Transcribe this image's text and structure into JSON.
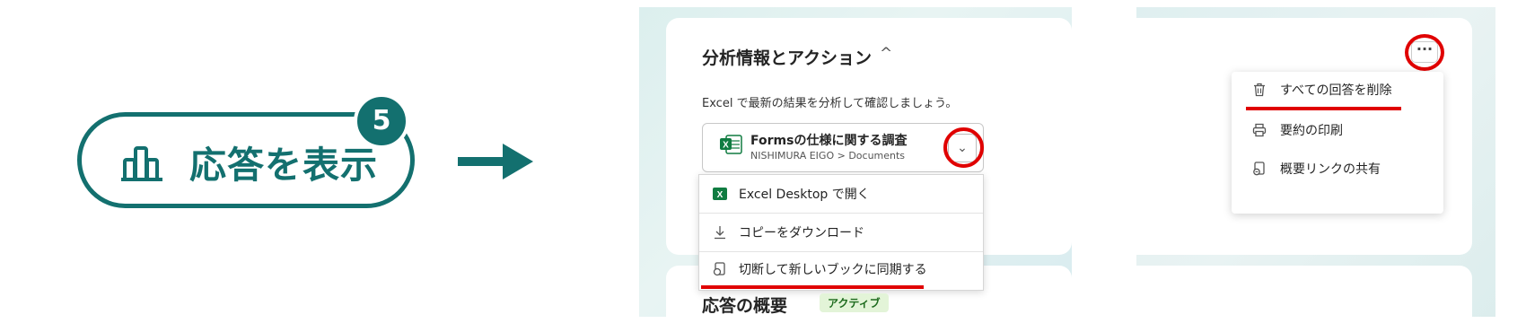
{
  "step": {
    "label": "応答を表示",
    "number": "5",
    "icon": "bar-chart-icon"
  },
  "analytics_card": {
    "title": "分析情報とアクション",
    "caret": "^",
    "subtitle": "Excel で最新の結果を分析して確認しましょう。",
    "file": {
      "name": "Formsの仕様に関する調査",
      "path": "NISHIMURA EIGO > Documents",
      "icon": "excel-file-icon",
      "chevron": "⌄"
    },
    "dropdown": [
      {
        "label": "Excel Desktop で開く",
        "icon": "excel-icon"
      },
      {
        "label": "コピーをダウンロード",
        "icon": "download-icon"
      },
      {
        "label": "切断して新しいブックに同期する",
        "icon": "sync-book-icon"
      }
    ]
  },
  "summary_card": {
    "title": "応答の概要",
    "badge": "アクティブ"
  },
  "more_menu": {
    "button": "···",
    "items": [
      {
        "label": "すべての回答を削除",
        "icon": "trash-icon"
      },
      {
        "label": "要約の印刷",
        "icon": "print-icon"
      },
      {
        "label": "概要リンクの共有",
        "icon": "share-link-icon"
      }
    ]
  },
  "colors": {
    "brand": "#13706f",
    "highlight": "#e00000",
    "active_badge_bg": "#e3f4d8",
    "excel_green": "#107c41"
  }
}
